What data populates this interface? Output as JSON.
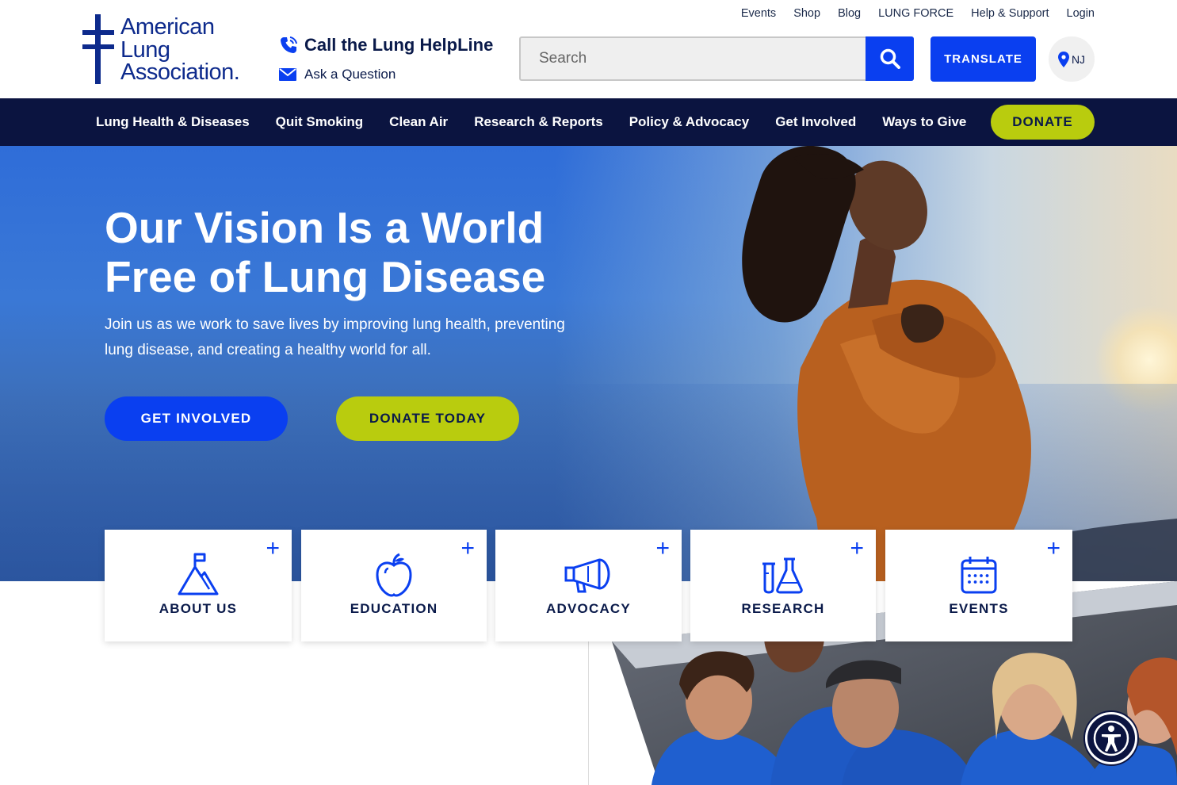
{
  "brand": {
    "name_line1": "American",
    "name_line2": "Lung",
    "name_line3": "Association.",
    "color": "#0d2a8c"
  },
  "contact": {
    "helpline_label": "Call the Lung HelpLine",
    "ask_label": "Ask a Question"
  },
  "utility_nav": [
    "Events",
    "Shop",
    "Blog",
    "LUNG FORCE",
    "Help & Support",
    "Login"
  ],
  "search": {
    "placeholder": "Search",
    "value": ""
  },
  "translate_label": "TRANSLATE",
  "state": {
    "code": "NJ",
    "icon": "location-pin-icon"
  },
  "main_nav": [
    "Lung Health & Diseases",
    "Quit Smoking",
    "Clean Air",
    "Research & Reports",
    "Policy & Advocacy",
    "Get Involved",
    "Ways to Give"
  ],
  "donate_nav_label": "DONATE",
  "hero": {
    "title_line1": "Our Vision Is a World",
    "title_line2": "Free of Lung Disease",
    "subtitle": "Join us as we work to save lives by improving lung health, preventing lung disease, and creating a healthy world for all.",
    "primary_button": "GET INVOLVED",
    "secondary_button": "DONATE TODAY"
  },
  "cards": [
    {
      "label": "ABOUT US",
      "icon": "mountain-flag-icon"
    },
    {
      "label": "EDUCATION",
      "icon": "apple-icon"
    },
    {
      "label": "ADVOCACY",
      "icon": "megaphone-icon"
    },
    {
      "label": "RESEARCH",
      "icon": "flask-icon"
    },
    {
      "label": "EVENTS",
      "icon": "calendar-icon"
    }
  ],
  "colors": {
    "primary_blue": "#0a3ff0",
    "navy": "#0b1440",
    "lime": "#b9cc0e"
  }
}
